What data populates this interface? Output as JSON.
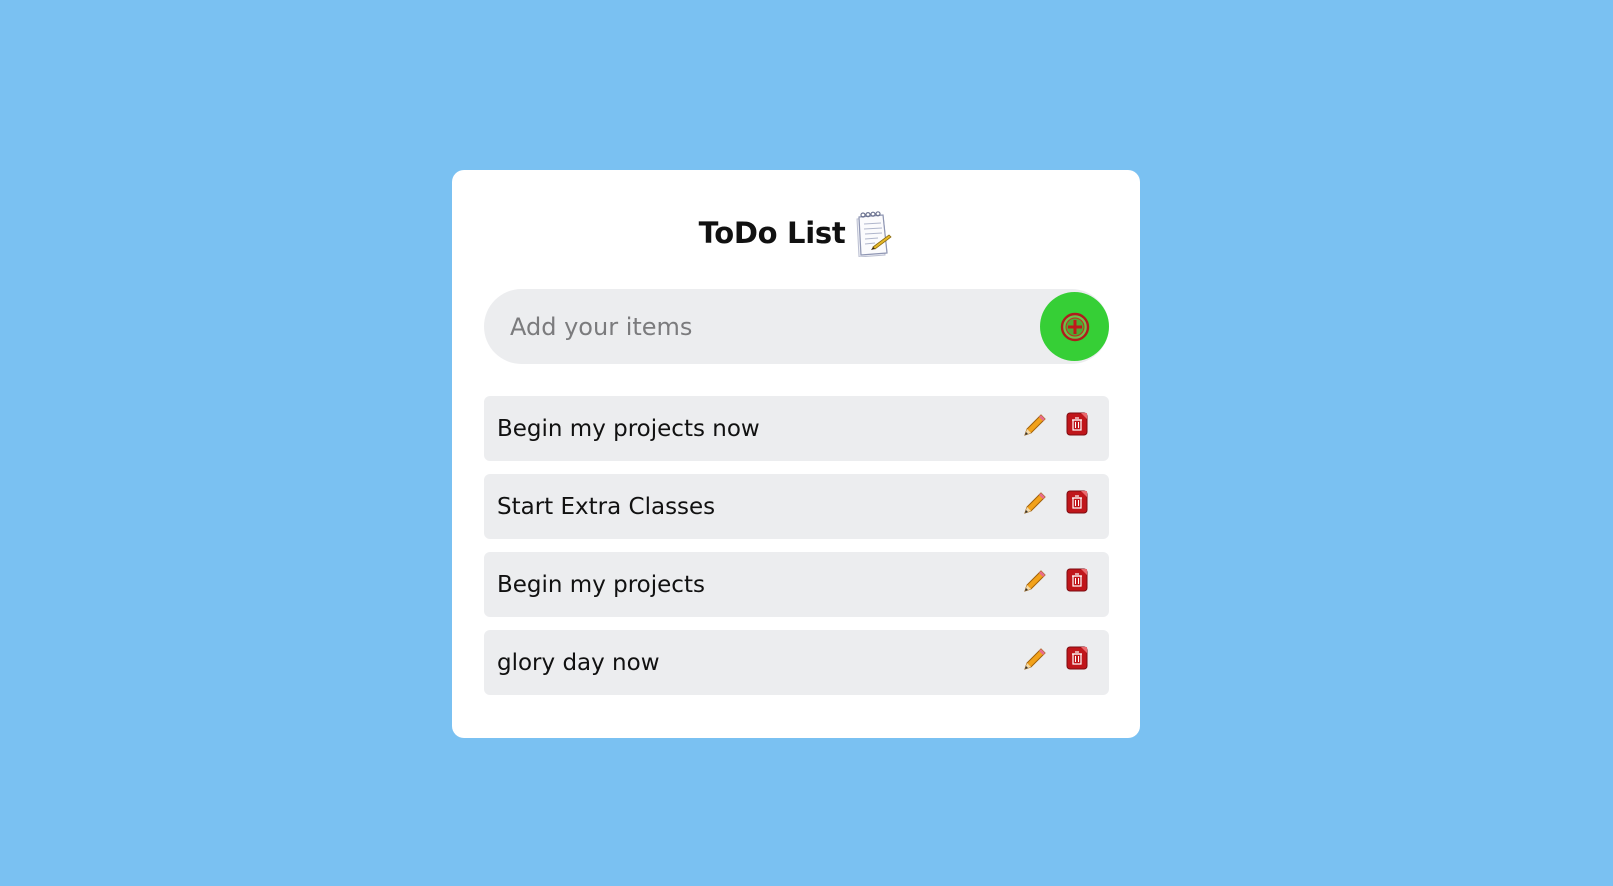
{
  "app": {
    "title": "ToDo List",
    "title_icon": "notepad-icon"
  },
  "input": {
    "placeholder": "Add your items",
    "value": ""
  },
  "add_button": {
    "icon": "add-circle-icon",
    "color": "#36cf36"
  },
  "items": [
    {
      "label": "Begin my projects now"
    },
    {
      "label": "Start Extra Classes"
    },
    {
      "label": "Begin my projects"
    },
    {
      "label": "glory day now"
    }
  ],
  "item_actions": {
    "edit_icon": "pencil-icon",
    "delete_icon": "trash-icon"
  },
  "colors": {
    "background": "#7ac1f2",
    "card": "#ffffff",
    "row": "#ecedef",
    "delete": "#c0161b"
  }
}
